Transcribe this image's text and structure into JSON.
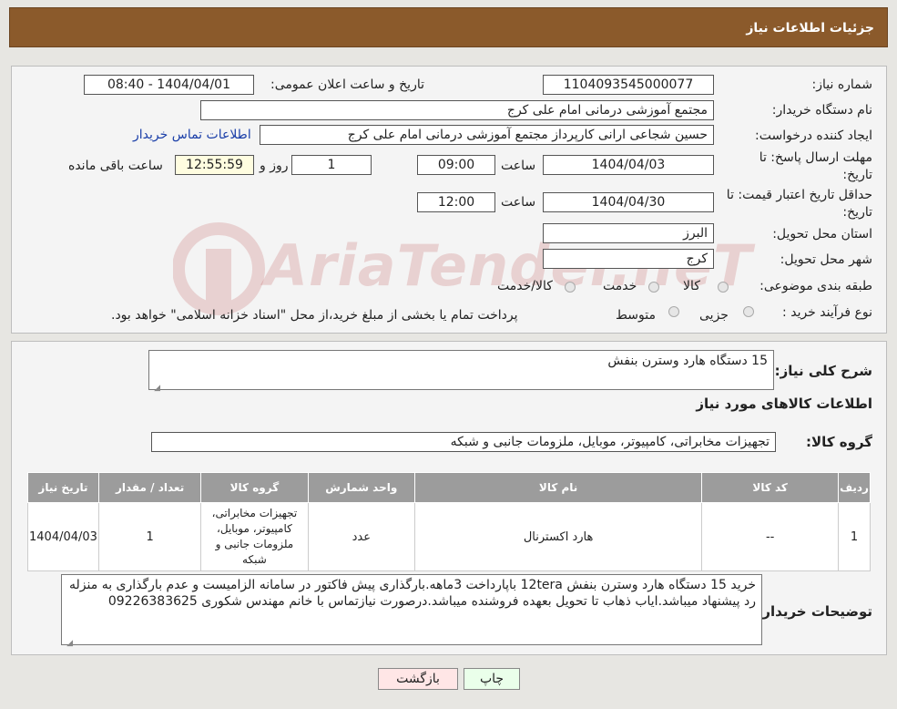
{
  "header": {
    "title": "جزئیات اطلاعات نیاز"
  },
  "info": {
    "need_number_label": "شماره نیاز:",
    "need_number": "1104093545000077",
    "announce_label": "تاریخ و ساعت اعلان عمومی:",
    "announce_value": "1404/04/01 - 08:40",
    "buyer_org_label": "نام دستگاه خریدار:",
    "buyer_org": "مجتمع آموزشی درمانی امام علی کرج",
    "creator_label": "ایجاد کننده درخواست:",
    "creator": "حسین شجاعی ارانی کارپرداز مجتمع آموزشی درمانی امام علی کرج",
    "contact_link": "اطلاعات تماس خریدار",
    "deadline_label_1": "مهلت ارسال پاسخ: تا",
    "deadline_label_2": "تاریخ:",
    "deadline_date": "1404/04/03",
    "hour_label": "ساعت",
    "deadline_time": "09:00",
    "days_value": "1",
    "days_label": "روز و",
    "remaining_time": "12:55:59",
    "remaining_label": "ساعت باقی مانده",
    "validity_label_1": "حداقل تاریخ اعتبار قیمت: تا",
    "validity_label_2": "تاریخ:",
    "validity_date": "1404/04/30",
    "validity_hour_label": "ساعت",
    "validity_time": "12:00",
    "province_label": "استان محل تحویل:",
    "province": "البرز",
    "city_label": "شهر محل تحویل:",
    "city": "کرج",
    "category_label": "طبقه بندی موضوعی:",
    "category_options": [
      "کالا",
      "خدمت",
      "کالا/خدمت"
    ],
    "purchase_type_label": "نوع فرآیند خرید :",
    "purchase_type_options": [
      "جزیی",
      "متوسط"
    ],
    "purchase_note": "پرداخت تمام یا بخشی از مبلغ خرید،از محل \"اسناد خزانه اسلامی\" خواهد بود."
  },
  "watermark": {
    "text": "AriaTender.neT"
  },
  "summary": {
    "general_desc_label": "شرح کلی نیاز:",
    "general_desc": "15 دستگاه هارد وسترن بنفش",
    "goods_info_title": "اطلاعات کالاهای مورد نیاز",
    "goods_group_label": "گروه کالا:",
    "goods_group": "تجهیزات مخابراتی، کامپیوتر، موبایل، ملزومات جانبی و شبکه"
  },
  "table": {
    "headers": [
      "ردیف",
      "کد کالا",
      "نام کالا",
      "واحد شمارش",
      "گروه کالا",
      "تعداد / مقدار",
      "تاریخ نیاز"
    ],
    "rows": [
      [
        "1",
        "--",
        "هارد اکسترنال",
        "عدد",
        "تجهیزات مخابراتی، کامپیوتر، موبایل، ملزومات جانبی و شبکه",
        "1",
        "1404/04/03"
      ]
    ]
  },
  "buyer_notes": {
    "label": "توضیحات خریدار:",
    "text": "خرید 15 دستگاه هارد وسترن بنفش 12tera باپارداخت 3ماهه.بارگذاری پیش فاکتور در سامانه الزامیست و عدم بارگذاری به منزله رد پیشنهاد میباشد.ایاب ذهاب تا تحویل بعهده فروشنده میباشد.درصورت نیازتماس با خانم مهندس شکوری 09226383625"
  },
  "buttons": {
    "print": "چاپ",
    "back": "بازگشت"
  },
  "colors": {
    "header": "#8b5a2b",
    "print_btn": "#eaffea",
    "back_btn": "#ffe6e6"
  }
}
